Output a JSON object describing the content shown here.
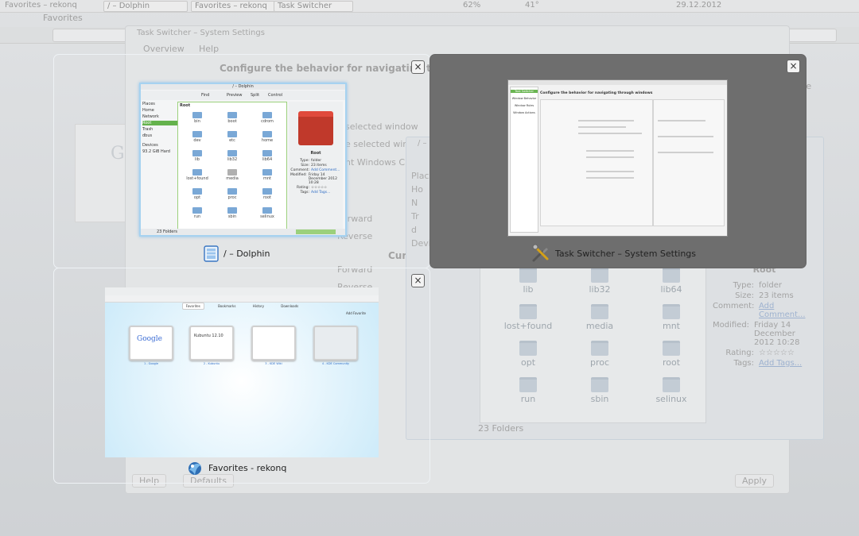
{
  "taskbar": {
    "app_title": "Favorites – rekonq",
    "tasks": [
      "/ – Dolphin",
      "Favorites – rekonq",
      "Task Switcher"
    ],
    "battery": "62%",
    "temperature": "41°",
    "date": "29.12.2012"
  },
  "background_browser": {
    "tab": "Favorites"
  },
  "background_settings": {
    "title": "Task Switcher – System Settings",
    "toolbar": [
      "Overview",
      "Help"
    ],
    "heading": "Configure the behavior for navigating through",
    "lines": [
      "selected window",
      "e selected windo",
      "nt Windows Cl",
      "Forward",
      "Reverse",
      "Forward",
      "Reverse",
      "Curr"
    ],
    "buttons": {
      "help": "Help",
      "defaults": "Defaults",
      "apply": "Apply"
    },
    "right_edge": "ite"
  },
  "background_dolphin": {
    "title": "/ – D",
    "places": [
      "Places",
      "Ho",
      "N",
      "Tr",
      "d",
      "Devic"
    ],
    "folders": [
      "lib",
      "lib32",
      "lib64",
      "lost+found",
      "media",
      "mnt",
      "opt",
      "proc",
      "root",
      "run",
      "sbin",
      "selinux"
    ],
    "info": {
      "name": "Root",
      "rows": [
        {
          "k": "Type:",
          "v": "folder"
        },
        {
          "k": "Size:",
          "v": "23 items"
        },
        {
          "k": "Comment:",
          "v": "Add Comment..."
        },
        {
          "k": "Modified:",
          "v": "Friday 14 December 2012 10:28"
        },
        {
          "k": "Rating:",
          "v": "☆☆☆☆☆"
        },
        {
          "k": "Tags:",
          "v": "Add Tags..."
        }
      ]
    },
    "status": "23 Folders"
  },
  "switcher": {
    "dolphin": {
      "caption": "/ – Dolphin",
      "thumb": {
        "title": "/ – Dolphin",
        "toolbar": [
          "Find",
          "Preview",
          "Split",
          "Control"
        ],
        "places": [
          "Places",
          "Home",
          "Network",
          "Root",
          "Trash",
          "dbus",
          "Devices",
          "93.2 GiB Hard"
        ],
        "header": "Root",
        "folders": [
          "bin",
          "boot",
          "cdrom",
          "dev",
          "etc",
          "home",
          "lib",
          "lib32",
          "lib64",
          "lost+found",
          "media",
          "mnt",
          "opt",
          "proc",
          "root",
          "run",
          "sbin",
          "selinux"
        ],
        "info_name": "Root",
        "info_rows": [
          {
            "k": "Type:",
            "v": "folder"
          },
          {
            "k": "Size:",
            "v": "23 items"
          },
          {
            "k": "Comment:",
            "v": "Add Comment..."
          },
          {
            "k": "Modified:",
            "v": "Friday 14 December 2012 10:28"
          },
          {
            "k": "Rating:",
            "v": "☆☆☆☆☆"
          },
          {
            "k": "Tags:",
            "v": "Add Tags..."
          }
        ],
        "status": "23 Folders"
      }
    },
    "settings": {
      "caption": "Task Switcher – System Settings",
      "thumb": {
        "heading": "Configure the behavior for navigating through windows",
        "side": [
          "Task Switcher",
          "Window Behavior",
          "Window Rules",
          "Window Actions"
        ]
      }
    },
    "rekonq": {
      "caption": "Favorites - rekonq",
      "thumb": {
        "nav": [
          "Favorites",
          "Bookmarks",
          "History",
          "Downloads"
        ],
        "add": "Add Favorite",
        "cards": [
          "1 - Google",
          "2 - Kubuntu",
          "3 - KDE Wiki",
          "4 - KDE Community"
        ],
        "kubuntu": "Kubuntu 12.10"
      }
    },
    "icons": {
      "close": "close-icon"
    }
  }
}
